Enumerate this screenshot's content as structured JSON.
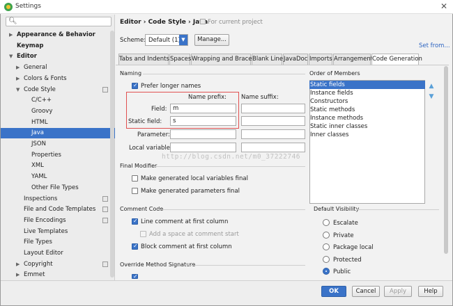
{
  "window": {
    "title": "Settings",
    "close": "✕"
  },
  "search": {
    "icon": "search-icon",
    "placeholder": ""
  },
  "sidebar": {
    "items": [
      {
        "label": "Appearance & Behavior",
        "bold": true,
        "arrow": "▶"
      },
      {
        "label": "Keymap",
        "bold": true,
        "arrow": ""
      },
      {
        "label": "Editor",
        "bold": true,
        "arrow": "▼"
      },
      {
        "label": "General",
        "arrow": "▶"
      },
      {
        "label": "Colors & Fonts",
        "arrow": "▶"
      },
      {
        "label": "Code Style",
        "arrow": "▼"
      },
      {
        "label": "C/C++"
      },
      {
        "label": "Groovy"
      },
      {
        "label": "HTML"
      },
      {
        "label": "Java",
        "selected": true
      },
      {
        "label": "JSON"
      },
      {
        "label": "Properties"
      },
      {
        "label": "XML"
      },
      {
        "label": "YAML"
      },
      {
        "label": "Other File Types"
      },
      {
        "label": "Inspections"
      },
      {
        "label": "File and Code Templates"
      },
      {
        "label": "File Encodings"
      },
      {
        "label": "Live Templates"
      },
      {
        "label": "File Types"
      },
      {
        "label": "Layout Editor"
      },
      {
        "label": "Copyright",
        "arrow": "▶"
      },
      {
        "label": "Emmet",
        "arrow": "▶"
      }
    ]
  },
  "breadcrumb": {
    "path": "Editor › Code Style › Java",
    "note": "For current project"
  },
  "scheme": {
    "label": "Scheme:",
    "value": "Default (1)",
    "manage": "Manage...",
    "set_from": "Set from..."
  },
  "tabs": [
    "Tabs and Indents",
    "Spaces",
    "Wrapping and Braces",
    "Blank Lines",
    "JavaDoc",
    "Imports",
    "Arrangement",
    "Code Generation"
  ],
  "naming": {
    "title": "Naming",
    "prefer_longer": "Prefer longer names",
    "prefix_header": "Name prefix:",
    "suffix_header": "Name suffix:",
    "rows": [
      {
        "label": "Field:",
        "prefix": "m",
        "suffix": ""
      },
      {
        "label": "Static field:",
        "prefix": "s",
        "suffix": ""
      },
      {
        "label": "Parameter:",
        "prefix": "",
        "suffix": ""
      },
      {
        "label": "Local variable:",
        "prefix": "",
        "suffix": ""
      }
    ]
  },
  "order": {
    "title": "Order of Members",
    "items": [
      "Static fields",
      "Instance fields",
      "Constructors",
      "Static methods",
      "Instance methods",
      "Static inner classes",
      "Inner classes"
    ],
    "up_icon": "arrow-up-icon",
    "down_icon": "arrow-down-icon"
  },
  "final_modifier": {
    "title": "Final Modifier",
    "local_vars": "Make generated local variables final",
    "params": "Make generated parameters final"
  },
  "comment_code": {
    "title": "Comment Code",
    "line_comment": "Line comment at first column",
    "add_space": "Add a space at comment start",
    "block_comment": "Block comment at first column"
  },
  "visibility": {
    "title": "Default Visibility",
    "options": [
      "Escalate",
      "Private",
      "Package local",
      "Protected",
      "Public"
    ],
    "selected": "Public"
  },
  "override": {
    "title": "Override Method Signature"
  },
  "watermark": "http://blog.csdn.net/m0_37222746",
  "buttons": {
    "ok": "OK",
    "cancel": "Cancel",
    "apply": "Apply",
    "help": "Help"
  },
  "colors": {
    "accent": "#3a73c8",
    "highlight_box": "#e05050"
  }
}
